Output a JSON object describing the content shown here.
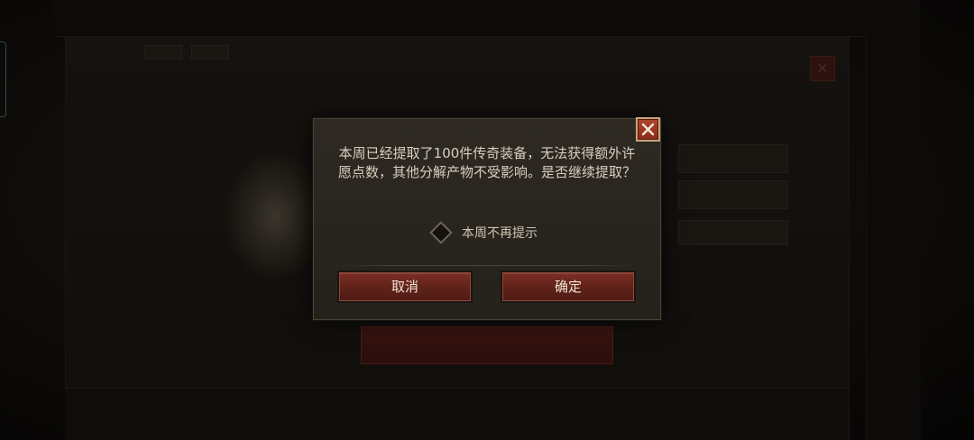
{
  "background": {
    "window_title": "",
    "panel_title": "",
    "action_button_label": ""
  },
  "dialog": {
    "message": "本周已经提取了100件传奇装备，无法获得额外许愿点数，其他分解产物不受影响。是否继续提取？",
    "checkbox": {
      "label": "本周不再提示",
      "checked": false
    },
    "cancel_label": "取消",
    "confirm_label": "确定",
    "close_icon": "close-icon"
  },
  "colors": {
    "dialog_bg": "#2b2720",
    "button_red": "#6a271e",
    "close_button": "#a43b27",
    "text": "#d9cfbf"
  }
}
